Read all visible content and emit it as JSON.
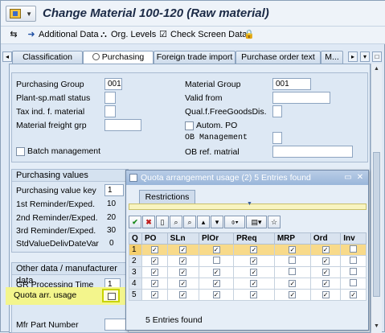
{
  "window": {
    "title": "Change Material 100-120 (Raw material)"
  },
  "toolbar": {
    "additional_data": "Additional Data",
    "org_levels": "Org. Levels",
    "check_screen_data": "Check Screen Data"
  },
  "tabs": [
    "Classification",
    "Purchasing",
    "Foreign trade import",
    "Purchase order text",
    "M..."
  ],
  "general": {
    "purchasing_group_label": "Purchasing Group",
    "purchasing_group_value": "001",
    "plant_sp_matl_status_label": "Plant-sp.matl status",
    "tax_ind_label": "Tax ind. f. material",
    "material_freight_grp_label": "Material freight grp",
    "batch_management_label": "Batch management",
    "material_group_label": "Material Group",
    "material_group_value": "001",
    "valid_from_label": "Valid from",
    "qual_free_goods_label": "Qual.f.FreeGoodsDis.",
    "autom_po_label": "Autom. PO",
    "ob_management_label": "OB Management",
    "ob_ref_matrial_label": "OB ref. matrial"
  },
  "purchasing_values": {
    "title": "Purchasing values",
    "value_key_label": "Purchasing value key",
    "value_key": "1",
    "reminder1_label": "1st Reminder/Exped.",
    "reminder1": "10",
    "reminder2_label": "2nd Reminder/Exped.",
    "reminder2": "20",
    "reminder3_label": "3rd Reminder/Exped.",
    "reminder3": "30",
    "std_value_label": "StdValueDelivDateVar",
    "std_value": "0"
  },
  "other_data": {
    "title": "Other data / manufacturer data",
    "gr_time_label": "GR Processing Time",
    "gr_time": "1",
    "quota_label": "Quota arr. usage",
    "mfr_part_label": "Mfr Part Number"
  },
  "popup": {
    "title": "Quota arrangement usage (2)   5 Entries found",
    "restrictions_tab": "Restrictions",
    "status": "5 Entries found",
    "columns": [
      "Q",
      "PO",
      "SLn",
      "PlOr",
      "PReq",
      "MRP",
      "Ord",
      "Inv"
    ],
    "rows": [
      {
        "q": "1",
        "checks": [
          true,
          true,
          true,
          true,
          true,
          true,
          false
        ]
      },
      {
        "q": "2",
        "checks": [
          true,
          true,
          false,
          true,
          false,
          true,
          false
        ]
      },
      {
        "q": "3",
        "checks": [
          true,
          true,
          true,
          true,
          false,
          true,
          false
        ]
      },
      {
        "q": "4",
        "checks": [
          true,
          true,
          true,
          true,
          true,
          true,
          false
        ]
      },
      {
        "q": "5",
        "checks": [
          true,
          true,
          true,
          true,
          true,
          true,
          true
        ]
      }
    ]
  }
}
